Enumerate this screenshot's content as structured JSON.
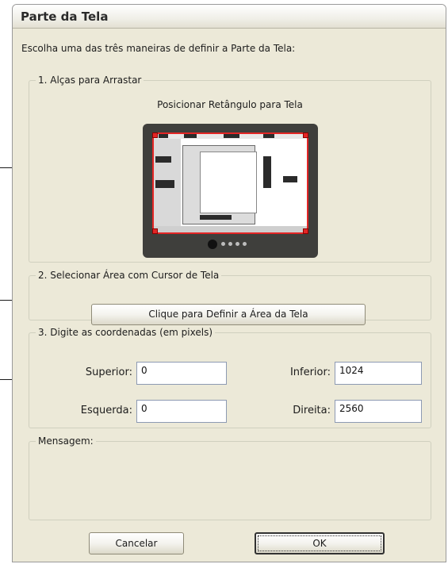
{
  "window": {
    "title": "Parte da Tela"
  },
  "instruction": "Escolha uma das três maneiras de definir a Parte da Tela:",
  "section1": {
    "legend": "1. Alças para Arrastar",
    "preview_label": "Posicionar Retângulo para Tela"
  },
  "section2": {
    "legend": "2. Selecionar Área com Cursor de Tela",
    "button_label": "Clique para Definir a Área da Tela"
  },
  "section3": {
    "legend": "3. Digite as coordenadas (em pixels)",
    "fields": {
      "top_label": "Superior:",
      "top_value": "0",
      "bottom_label": "Inferior:",
      "bottom_value": "1024",
      "left_label": "Esquerda:",
      "left_value": "0",
      "right_label": "Direita:",
      "right_value": "2560"
    }
  },
  "message": {
    "legend": "Mensagem:"
  },
  "buttons": {
    "cancel": "Cancelar",
    "ok": "OK"
  },
  "colors": {
    "dialog_bg": "#ece9d8",
    "handle": "#e32626",
    "monitor": "#3f3f3c"
  }
}
